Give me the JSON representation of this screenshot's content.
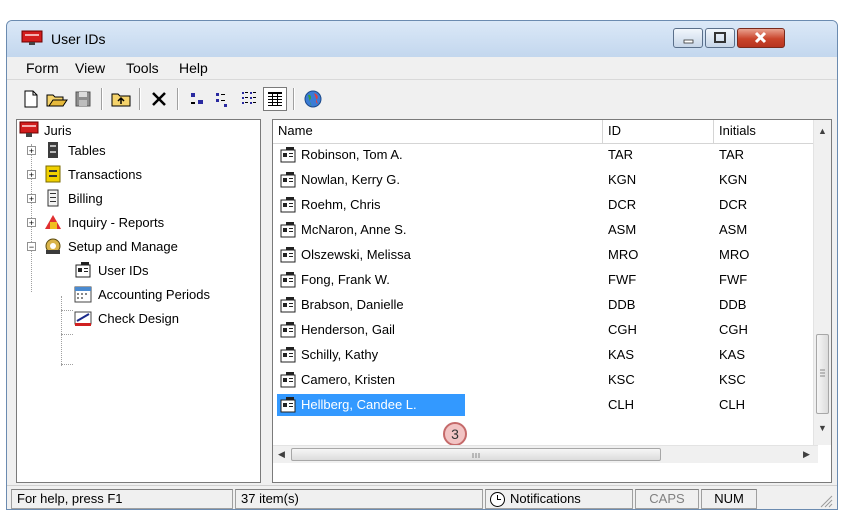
{
  "window": {
    "title": "User IDs",
    "icon": "juris-app-icon"
  },
  "menu": {
    "items": [
      "Form",
      "View",
      "Tools",
      "Help"
    ]
  },
  "toolbar": {
    "buttons": [
      "new-icon",
      "open-icon",
      "save-icon",
      "up-folder-icon",
      "delete-icon",
      "large-icons-icon",
      "small-icons-icon",
      "list-view-icon",
      "details-view-icon",
      "web-globe-icon"
    ]
  },
  "tree": {
    "root": "Juris",
    "items": [
      "Tables",
      "Transactions",
      "Billing",
      "Inquiry - Reports",
      "Setup and Manage"
    ],
    "children": [
      "User IDs",
      "Accounting Periods",
      "Check Design"
    ]
  },
  "list": {
    "columns": [
      "Name",
      "ID",
      "Initials"
    ],
    "rows": [
      {
        "name": "Robinson, Tom A.",
        "id": "TAR",
        "initials": "TAR"
      },
      {
        "name": "Nowlan, Kerry G.",
        "id": "KGN",
        "initials": "KGN"
      },
      {
        "name": "Roehm, Chris",
        "id": "DCR",
        "initials": "DCR"
      },
      {
        "name": "McNaron, Anne S.",
        "id": "ASM",
        "initials": "ASM"
      },
      {
        "name": "Olszewski, Melissa",
        "id": "MRO",
        "initials": "MRO"
      },
      {
        "name": "Fong, Frank W.",
        "id": "FWF",
        "initials": "FWF"
      },
      {
        "name": "Brabson, Danielle",
        "id": "DDB",
        "initials": "DDB"
      },
      {
        "name": "Henderson, Gail",
        "id": "CGH",
        "initials": "CGH"
      },
      {
        "name": "Schilly, Kathy",
        "id": "KAS",
        "initials": "KAS"
      },
      {
        "name": "Camero, Kristen",
        "id": "KSC",
        "initials": "KSC"
      },
      {
        "name": "Hellberg, Candee L.",
        "id": "CLH",
        "initials": "CLH",
        "selected": true
      }
    ],
    "callout": "3"
  },
  "status": {
    "help": "For help, press F1",
    "count": "37 item(s)",
    "notifications": "Notifications",
    "caps": "CAPS",
    "num": "NUM"
  },
  "colors": {
    "selection": "#3399ff",
    "titlebar": "#c9dcf0",
    "close_button": "#c9442b"
  }
}
